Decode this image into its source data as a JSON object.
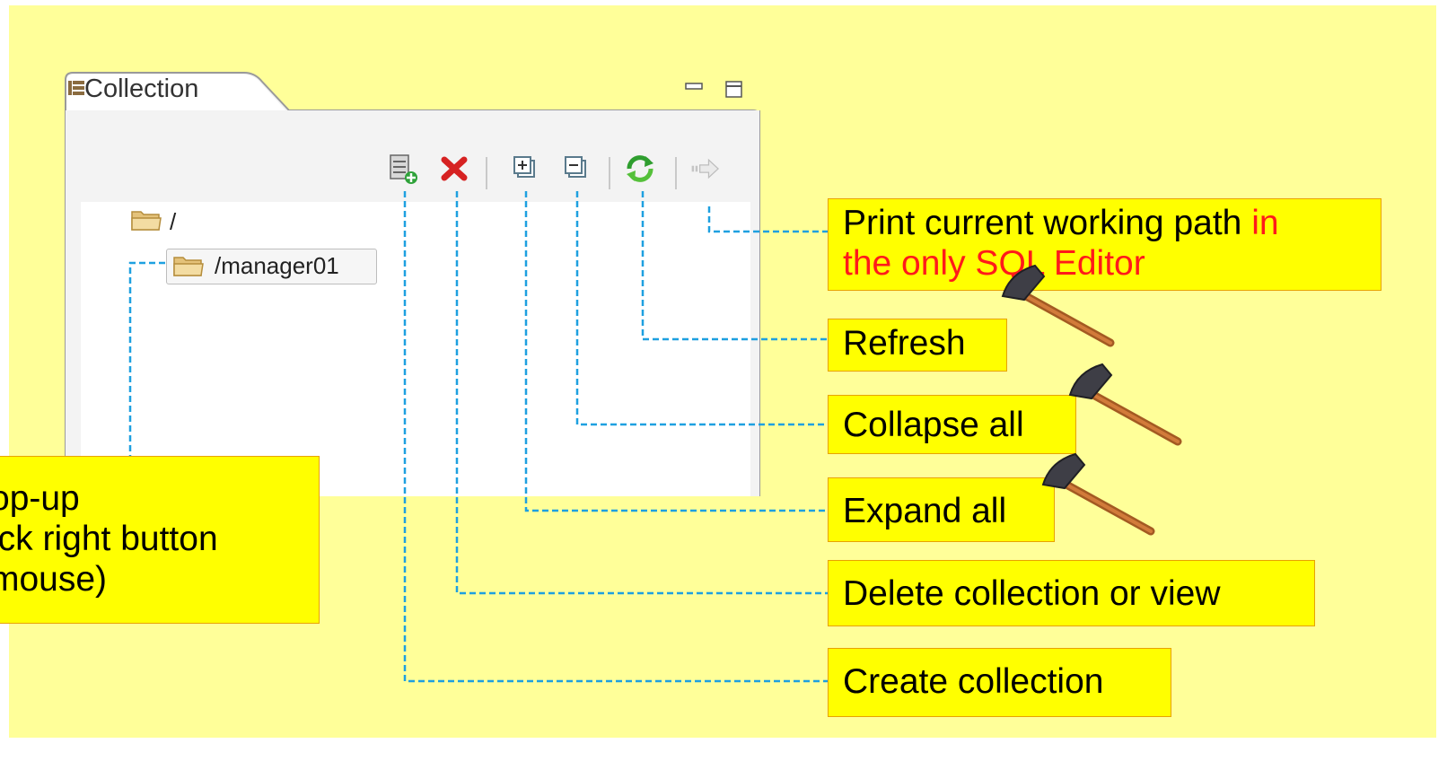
{
  "view": {
    "tab_title": "Collection",
    "tree": {
      "root_label": "/",
      "child_label": "/manager01"
    }
  },
  "toolbar": [
    {
      "name": "create-collection",
      "icon": "create-collection-icon"
    },
    {
      "name": "delete-collection",
      "icon": "delete-icon"
    },
    {
      "name": "expand-all",
      "icon": "expand-all-icon"
    },
    {
      "name": "collapse-all",
      "icon": "collapse-all-icon"
    },
    {
      "name": "refresh",
      "icon": "refresh-icon"
    },
    {
      "name": "print-path",
      "icon": "arrow-right-icon"
    }
  ],
  "callouts": {
    "print_path_line1_a": "Print current working path",
    "print_path_line1_b": "in",
    "print_path_line2": "the only SQL Editor",
    "refresh": "Refresh",
    "collapse_all": "Collapse all",
    "expand_all": "Expand all",
    "delete": "Delete collection or view",
    "create": "Create collection",
    "popup_line1": "op-up",
    "popup_line2": "ick right button",
    "popup_line3": "mouse)"
  },
  "colors": {
    "slide_background": "#ffff99",
    "callout_fill": "#ffff00",
    "callout_border": "#e8a200",
    "leader_line": "#1ea0e0",
    "highlight_text": "#ff1a1a"
  }
}
